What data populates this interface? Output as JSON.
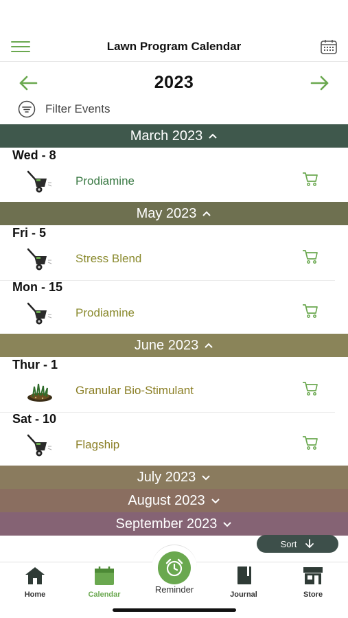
{
  "header": {
    "title": "Lawn Program Calendar",
    "menu_icon": "hamburger-icon",
    "calendar_icon": "calendar-grid-icon"
  },
  "year_nav": {
    "year": "2023",
    "prev_icon": "arrow-left-icon",
    "next_icon": "arrow-right-icon"
  },
  "filter": {
    "label": "Filter Events",
    "icon": "filter-icon"
  },
  "colors": {
    "accent": "#6aa84f",
    "march": "#3f584c",
    "may": "#6e7050",
    "june": "#8a8459",
    "july": "#8a7b5e",
    "august": "#8a6e60",
    "september": "#856374",
    "text_green": "#3b7a45",
    "text_olive": "#8a8a2e",
    "text_gold": "#8a7e24"
  },
  "months": [
    {
      "label": "March 2023",
      "expanded": true
    },
    {
      "label": "May 2023",
      "expanded": true
    },
    {
      "label": "June 2023",
      "expanded": true
    },
    {
      "label": "July 2023",
      "expanded": false
    },
    {
      "label": "August 2023",
      "expanded": false
    },
    {
      "label": "September 2023",
      "expanded": false
    }
  ],
  "events": [
    {
      "day": "Wed - 8",
      "product": "Prodiamine",
      "icon": "spreader-icon"
    },
    {
      "day": "Fri - 5",
      "product": "Stress Blend",
      "icon": "spreader-icon"
    },
    {
      "day": "Mon - 15",
      "product": "Prodiamine",
      "icon": "spreader-icon"
    },
    {
      "day": "Thur - 1",
      "product": "Granular Bio-Stimulant",
      "icon": "soil-grass-icon"
    },
    {
      "day": "Sat - 10",
      "product": "Flagship",
      "icon": "spreader-icon"
    }
  ],
  "sort": {
    "label": "Sort"
  },
  "tabs": [
    {
      "label": "Home",
      "icon": "home-icon"
    },
    {
      "label": "Calendar",
      "icon": "calendar-icon",
      "active": true
    },
    {
      "label": "Reminder",
      "icon": "alarm-clock-icon"
    },
    {
      "label": "Journal",
      "icon": "journal-icon"
    },
    {
      "label": "Store",
      "icon": "store-icon"
    }
  ]
}
